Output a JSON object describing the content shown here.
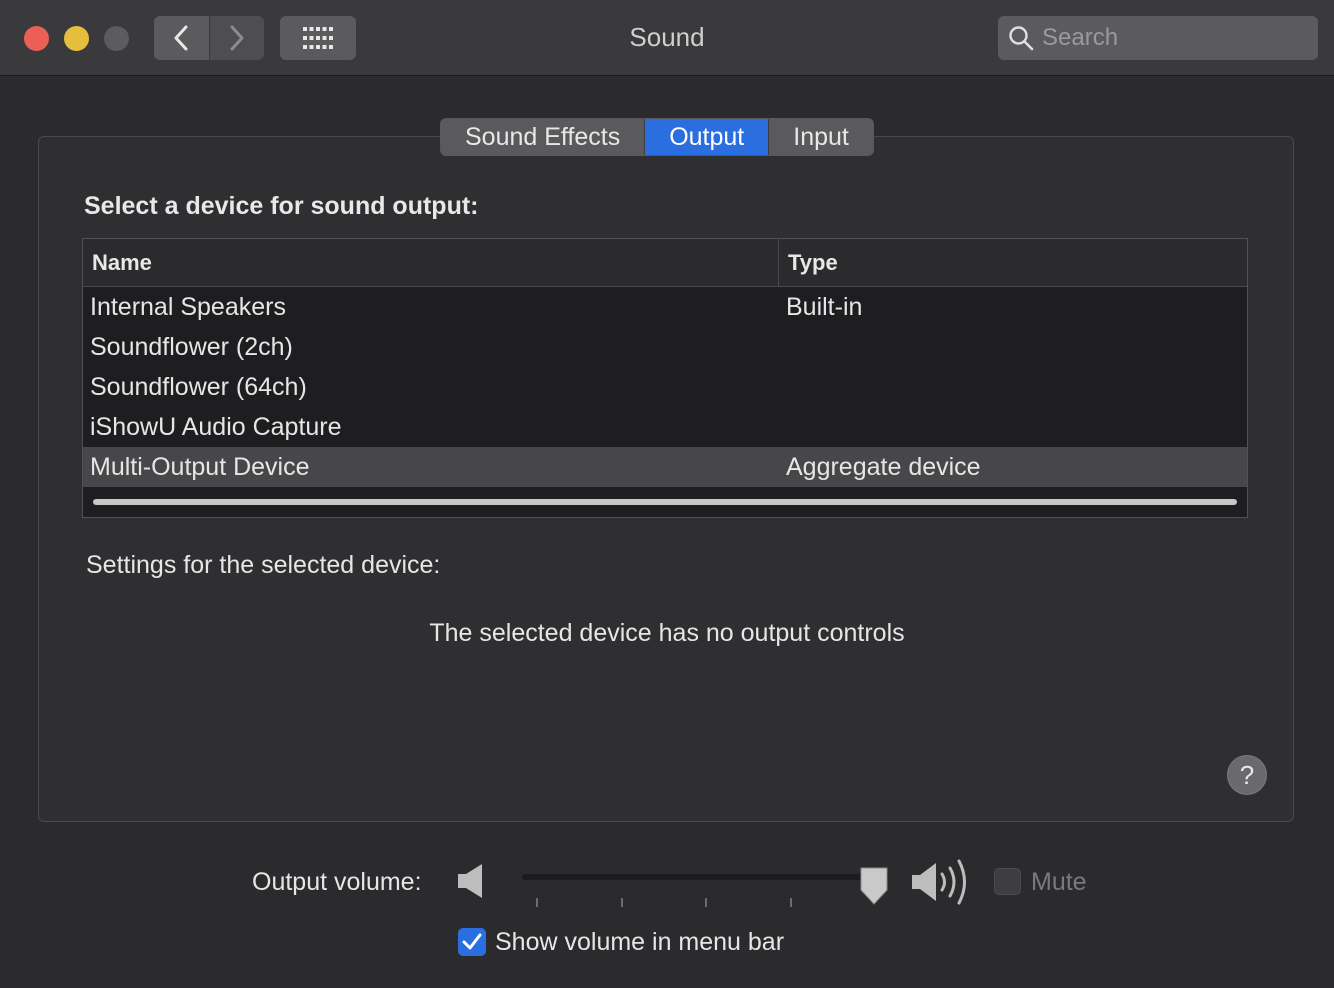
{
  "window": {
    "title": "Sound"
  },
  "search": {
    "placeholder": "Search"
  },
  "tabs": [
    {
      "label": "Sound Effects",
      "active": false
    },
    {
      "label": "Output",
      "active": true
    },
    {
      "label": "Input",
      "active": false
    }
  ],
  "output": {
    "section_title": "Select a device for sound output:",
    "columns": {
      "name": "Name",
      "type": "Type"
    },
    "devices": [
      {
        "name": "Internal Speakers",
        "type": "Built-in",
        "selected": false
      },
      {
        "name": "Soundflower (2ch)",
        "type": "",
        "selected": false
      },
      {
        "name": "Soundflower (64ch)",
        "type": "",
        "selected": false
      },
      {
        "name": "iShowU Audio Capture",
        "type": "",
        "selected": false
      },
      {
        "name": "Multi-Output Device",
        "type": "Aggregate device",
        "selected": true
      }
    ],
    "settings_label": "Settings for the selected device:",
    "no_controls": "The selected device has no output controls"
  },
  "help": {
    "label": "?"
  },
  "volume": {
    "label": "Output volume:",
    "level": 1.0,
    "mute_label": "Mute",
    "mute_checked": false,
    "mute_enabled": false
  },
  "menubar": {
    "label": "Show volume in menu bar",
    "checked": true
  },
  "colors": {
    "accent": "#2a6ee0",
    "close": "#ec5f57",
    "minimize": "#e5bf3b"
  },
  "icons": [
    "back-chevron-icon",
    "forward-chevron-icon",
    "grid-icon",
    "search-icon",
    "speaker-low-icon",
    "speaker-high-icon",
    "checkmark-icon",
    "question-mark-icon"
  ]
}
